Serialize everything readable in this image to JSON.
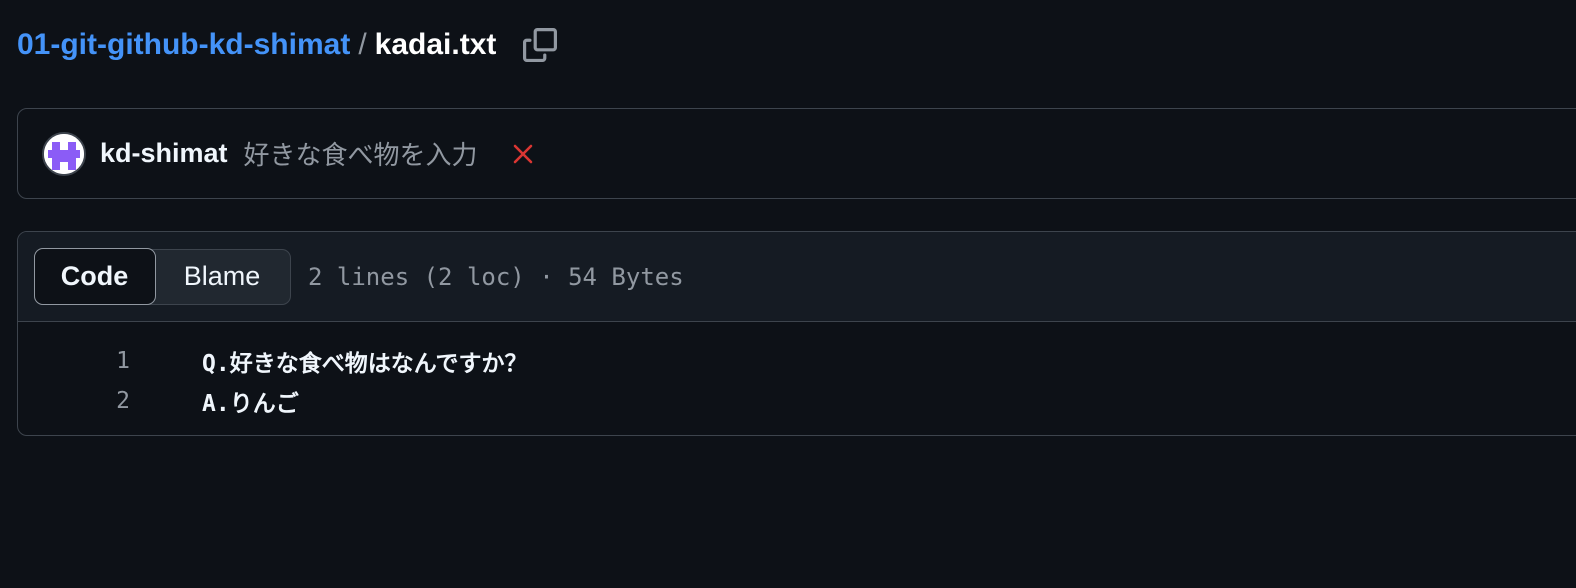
{
  "breadcrumb": {
    "repo": "01-git-github-kd-shimat",
    "separator": "/",
    "file": "kadai.txt"
  },
  "commit": {
    "author": "kd-shimat",
    "message": "好きな食べ物を入力",
    "status": "failure",
    "status_color": "#da3633"
  },
  "file_view": {
    "tabs": [
      {
        "label": "Code",
        "selected": true
      },
      {
        "label": "Blame",
        "selected": false
      }
    ],
    "meta": "2 lines (2 loc) · 54 Bytes",
    "lines": [
      {
        "number": "1",
        "content": "Q.好きな食べ物はなんですか？"
      },
      {
        "number": "2",
        "content": "A.りんご"
      }
    ]
  },
  "colors": {
    "background": "#0d1117",
    "link": "#4493f8",
    "border": "#3d444d",
    "muted": "#9198a1",
    "avatar": "#8b5cf6"
  },
  "icons": [
    "copy-icon",
    "x-icon",
    "avatar-identicon"
  ]
}
